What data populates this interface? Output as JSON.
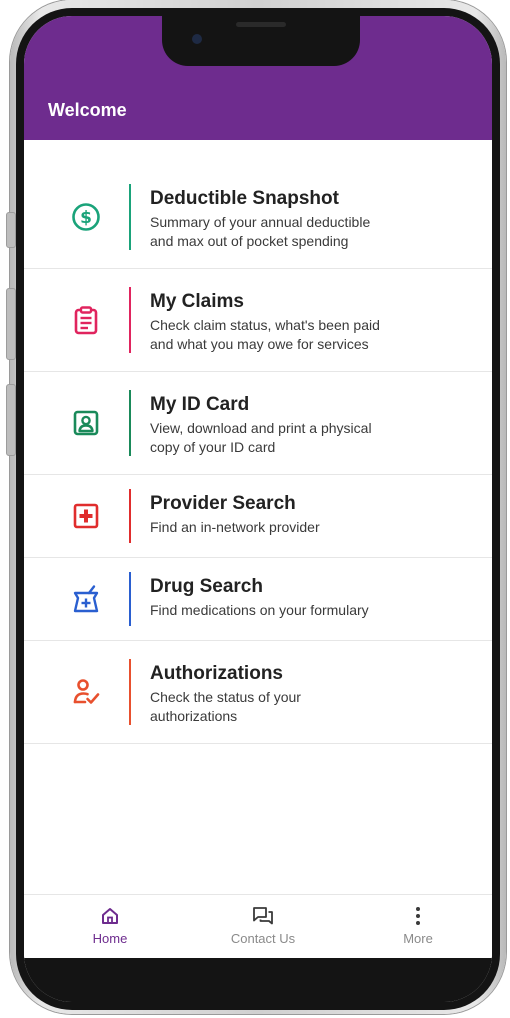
{
  "header": {
    "title": "Welcome",
    "background": "#6e2c8e"
  },
  "menu": {
    "items": [
      {
        "title": "Deductible Snapshot",
        "line1": "Summary of your annual deductible",
        "line2": "and max out of pocket spending",
        "icon": "dollar-circle-icon",
        "color": "#1aa37a"
      },
      {
        "title": "My Claims",
        "line1": "Check claim status, what's been paid",
        "line2": "and what you may owe for services",
        "icon": "clipboard-icon",
        "color": "#e0245e"
      },
      {
        "title": "My ID Card",
        "line1": "View, download and print a physical",
        "line2": "copy of your ID card",
        "icon": "id-card-icon",
        "color": "#1a8a5a"
      },
      {
        "title": "Provider Search",
        "line1": "Find an in-network provider",
        "icon": "medical-cross-icon",
        "color": "#e02d2d"
      },
      {
        "title": "Drug Search",
        "line1": "Find medications on your formulary",
        "icon": "prescription-bottle-icon",
        "color": "#2a5fd0"
      },
      {
        "title": "Authorizations",
        "line1": "Check the status of your",
        "line2": "authorizations",
        "icon": "person-check-icon",
        "color": "#e8502e"
      }
    ]
  },
  "tabbar": {
    "home": "Home",
    "contact": "Contact Us",
    "more": "More",
    "active_color": "#6e2c8e",
    "inactive_color": "#8a8a8a"
  }
}
